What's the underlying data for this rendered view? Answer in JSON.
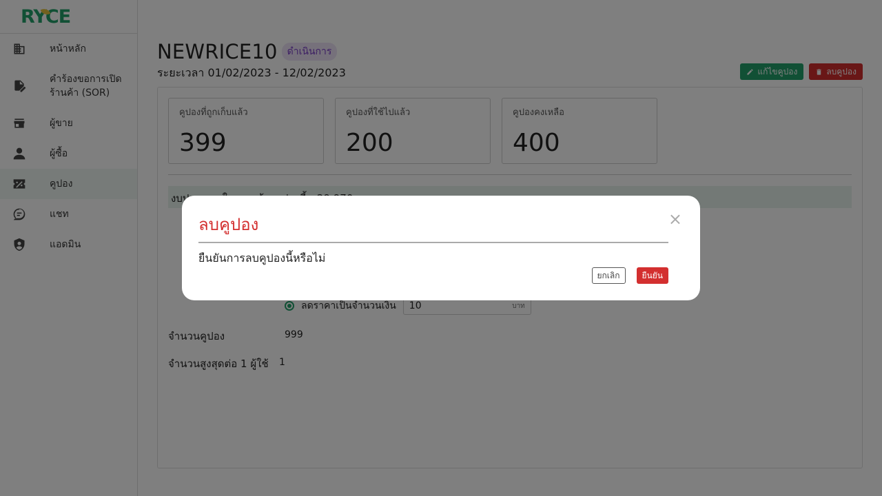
{
  "brand": {
    "logo_text": "RYCE",
    "primary_color": "#22a06b",
    "danger_color": "#d32f2f"
  },
  "sidebar": {
    "items": [
      {
        "label": "หน้าหลัก",
        "icon": "building-icon"
      },
      {
        "label": "คำร้องขอการเปิด\nร้านค้า (SOR)",
        "icon": "document-edit-icon"
      },
      {
        "label": "ผู้ขาย",
        "icon": "store-icon"
      },
      {
        "label": "ผู้ซื้อ",
        "icon": "person-icon"
      },
      {
        "label": "คูปอง",
        "icon": "coupon-icon",
        "active": true
      },
      {
        "label": "แชท",
        "icon": "chat-icon"
      },
      {
        "label": "แอดมิน",
        "icon": "admin-shield-icon"
      }
    ]
  },
  "coupon": {
    "code": "NEWRICE10",
    "status": "ดำเนินการ",
    "period": "ระยะเวลา 01/02/2023 - 12/02/2023",
    "edit_label": "แก้ไขคูปอง",
    "delete_label": "ลบคูปอง"
  },
  "stats": [
    {
      "label": "คูปองที่ถูกเก็บแล้ว",
      "value": "399"
    },
    {
      "label": "คูปองที่ใช้ไปแล้ว",
      "value": "200"
    },
    {
      "label": "คูปองคงเหลือ",
      "value": "400"
    }
  ],
  "details": {
    "budget_text": "งบประมาณในการสร้างคูปองนี้ - 29,970 บาท",
    "discount_option_label": "ลดราคาเป็นจำนวนเงิน",
    "discount_amount": "10",
    "discount_unit": "บาท",
    "quantity_label": "จำนวนคูปอง",
    "quantity_value": "999",
    "max_per_user_label": "จำนวนสูงสุดต่อ 1 ผู้ใช้",
    "max_per_user_value": "1"
  },
  "modal": {
    "title": "ลบคูปอง",
    "close": "×",
    "message": "ยืนยันการลบคูปองนี้หรือไม่",
    "cancel_label": "ยกเลิก",
    "confirm_label": "ยืนยัน"
  }
}
